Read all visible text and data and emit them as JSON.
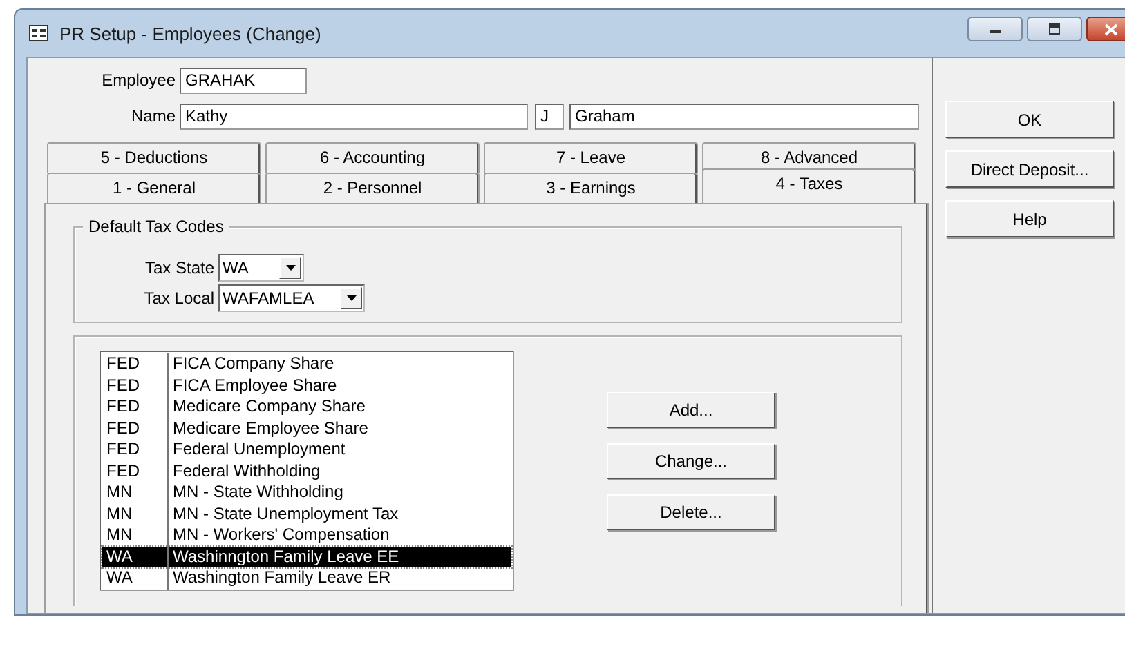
{
  "window": {
    "title": "PR Setup - Employees (Change)"
  },
  "employee": {
    "label": "Employee",
    "value": "GRAHAK"
  },
  "name": {
    "label": "Name",
    "first": "Kathy",
    "middle": "J",
    "last": "Graham"
  },
  "tab_rows": [
    [
      {
        "label": "5 - Deductions",
        "selected": false
      },
      {
        "label": "6 - Accounting",
        "selected": false
      },
      {
        "label": "7 - Leave",
        "selected": false
      },
      {
        "label": "8 - Advanced",
        "selected": false
      }
    ],
    [
      {
        "label": "1 - General",
        "selected": false
      },
      {
        "label": "2 - Personnel",
        "selected": false
      },
      {
        "label": "3 - Earnings",
        "selected": false
      },
      {
        "label": "4 - Taxes",
        "selected": true
      }
    ]
  ],
  "default_tax_codes": {
    "title": "Default Tax Codes",
    "fields": [
      {
        "label": "Tax State",
        "value": "WA"
      },
      {
        "label": "Tax Local",
        "value": "WAFAMLEA"
      }
    ]
  },
  "tax_list": [
    {
      "code": "FED",
      "description": "FICA Company Share",
      "selected": false
    },
    {
      "code": "FED",
      "description": "FICA Employee Share",
      "selected": false
    },
    {
      "code": "FED",
      "description": "Medicare Company Share",
      "selected": false
    },
    {
      "code": "FED",
      "description": "Medicare Employee Share",
      "selected": false
    },
    {
      "code": "FED",
      "description": "Federal Unemployment",
      "selected": false
    },
    {
      "code": "FED",
      "description": "Federal Withholding",
      "selected": false
    },
    {
      "code": "MN",
      "description": "MN - State Withholding",
      "selected": false
    },
    {
      "code": "MN",
      "description": "MN - State Unemployment Tax",
      "selected": false
    },
    {
      "code": "MN",
      "description": "MN - Workers' Compensation",
      "selected": false
    },
    {
      "code": "WA",
      "description": "Washinngton Family Leave EE",
      "selected": true
    },
    {
      "code": "WA",
      "description": "Washington Family Leave ER",
      "selected": false
    }
  ],
  "list_buttons": [
    "Add...",
    "Change...",
    "Delete..."
  ],
  "dialog_buttons": [
    "OK",
    "Direct Deposit...",
    "Help"
  ]
}
